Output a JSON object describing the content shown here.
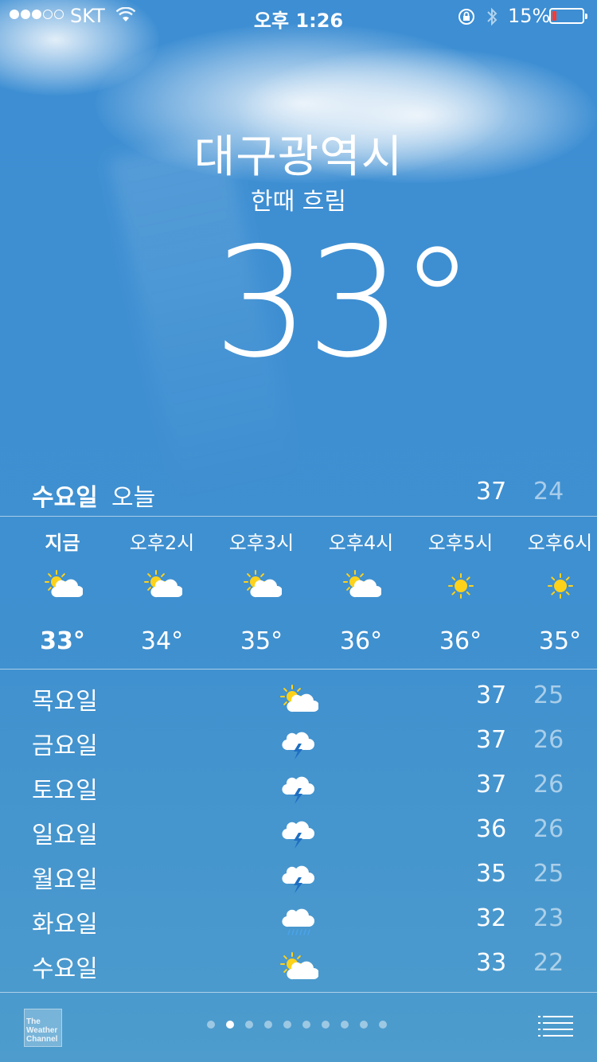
{
  "status_bar": {
    "carrier": "SKT",
    "signal_bars_full": 3,
    "signal_bars_total": 5,
    "time": "오후 1:26",
    "battery_percent": "15%",
    "battery_level": 0.15,
    "battery_color": "#ff3b30",
    "icons": [
      "wifi-icon",
      "orientation-lock-icon",
      "bluetooth-icon",
      "battery-icon"
    ]
  },
  "location": {
    "city": "대구광역시",
    "condition": "한때 흐림",
    "temperature": "33°"
  },
  "today": {
    "day": "수요일",
    "label": "오늘",
    "high": "37",
    "low": "24"
  },
  "hourly": [
    {
      "time": "지금",
      "icon": "partly-sunny",
      "temp": "33°"
    },
    {
      "time": "오후2시",
      "icon": "partly-sunny",
      "temp": "34°"
    },
    {
      "time": "오후3시",
      "icon": "partly-sunny",
      "temp": "35°"
    },
    {
      "time": "오후4시",
      "icon": "partly-sunny",
      "temp": "36°"
    },
    {
      "time": "오후5시",
      "icon": "sunny",
      "temp": "36°"
    },
    {
      "time": "오후6시",
      "icon": "sunny",
      "temp": "35°"
    }
  ],
  "daily": [
    {
      "day": "목요일",
      "icon": "partly-sunny",
      "high": "37",
      "low": "25"
    },
    {
      "day": "금요일",
      "icon": "thunderstorm",
      "high": "37",
      "low": "26"
    },
    {
      "day": "토요일",
      "icon": "thunderstorm",
      "high": "37",
      "low": "26"
    },
    {
      "day": "일요일",
      "icon": "thunderstorm",
      "high": "36",
      "low": "26"
    },
    {
      "day": "월요일",
      "icon": "thunderstorm",
      "high": "35",
      "low": "25"
    },
    {
      "day": "화요일",
      "icon": "rain",
      "high": "32",
      "low": "23"
    },
    {
      "day": "수요일",
      "icon": "partly-sunny",
      "high": "33",
      "low": "22"
    }
  ],
  "footer": {
    "logo_text": [
      "The",
      "Weather",
      "Channel"
    ],
    "page_count": 10,
    "active_page": 1
  },
  "colors": {
    "sun": "#ffd21a",
    "bolt": "#1f6fc2",
    "rain": "#4aa3e8"
  }
}
